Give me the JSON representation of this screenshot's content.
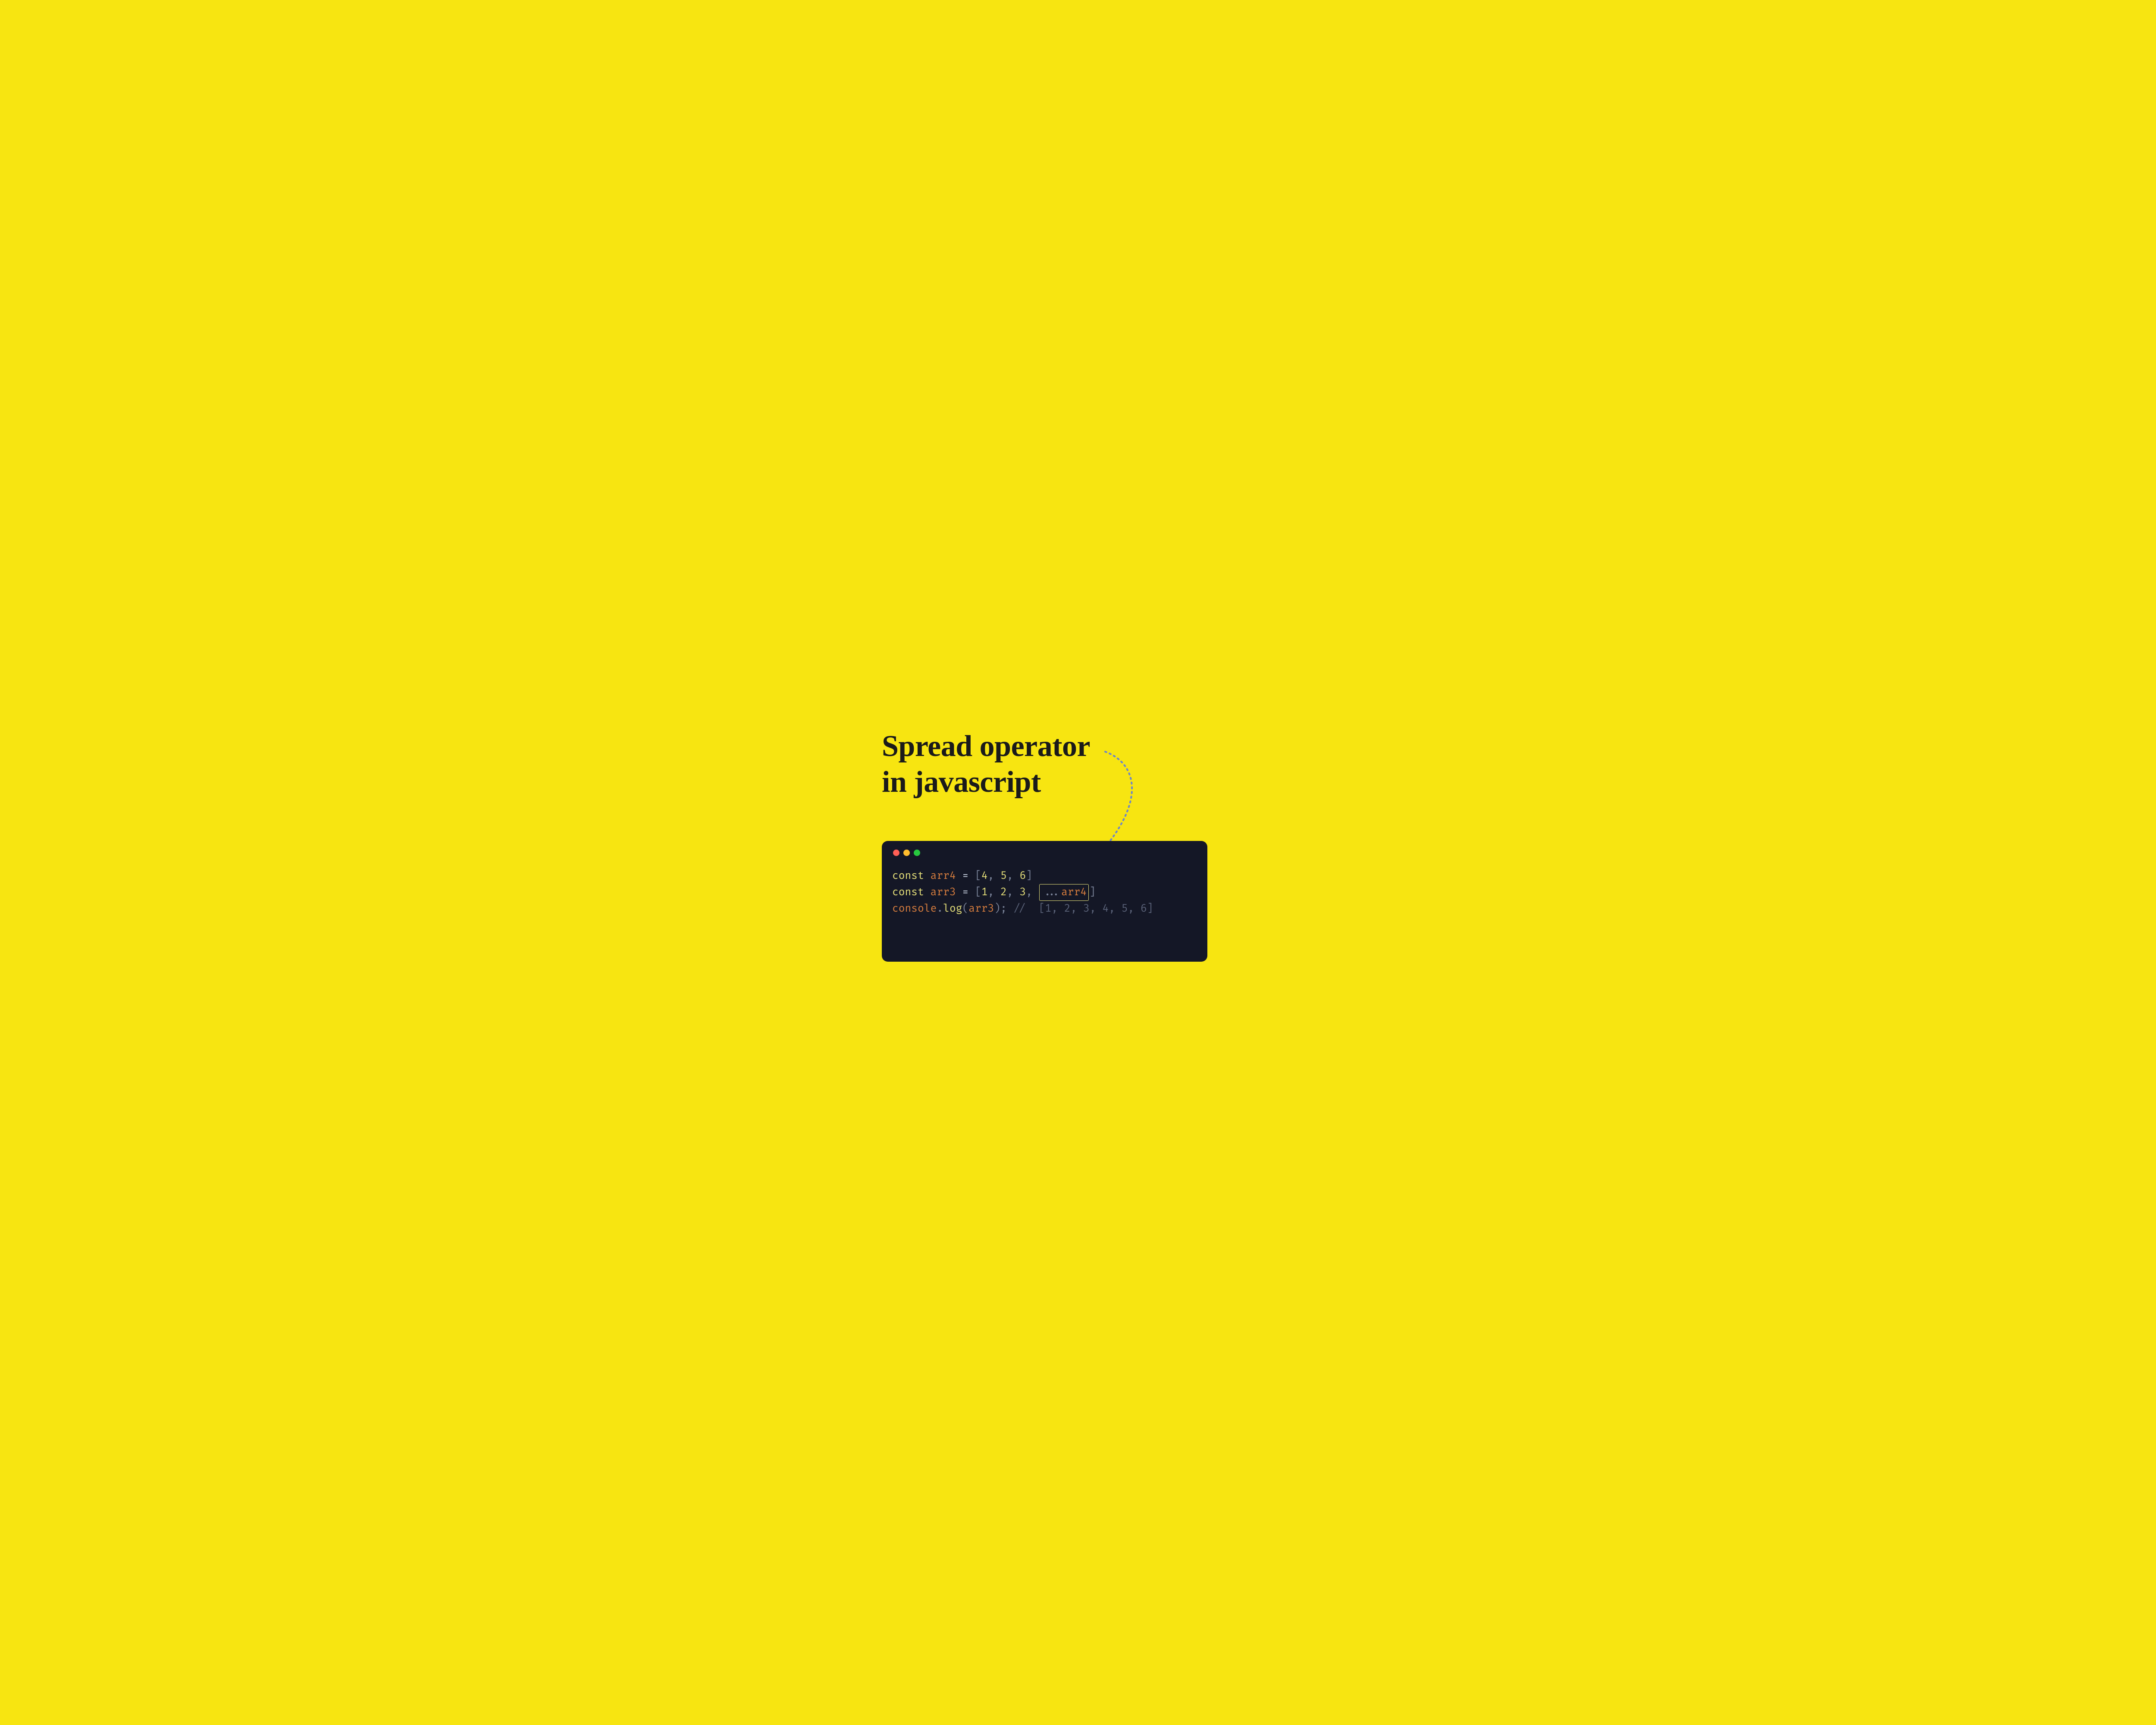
{
  "title_line1": "Spread operator",
  "title_line2": "in javascript",
  "code": {
    "line1": {
      "kw": "const",
      "var": "arr4",
      "eq": " = ",
      "open": "[",
      "n1": "4",
      "c1": ", ",
      "n2": "5",
      "c2": ", ",
      "n3": "6",
      "close": "]"
    },
    "line2": {
      "kw": "const",
      "var": "arr3",
      "eq": " = ",
      "open": "[",
      "n1": "1",
      "c1": ", ",
      "n2": "2",
      "c2": ", ",
      "n3": "3",
      "c3": ", ",
      "spread": "...",
      "spreadvar": "arr4",
      "close": "]"
    },
    "line3": {
      "obj": "console",
      "dot": ".",
      "method": "log",
      "open": "(",
      "arg": "arr3",
      "close": ")",
      "semi": ";",
      "comment": " //  [1, 2, 3, 4, 5, 6]"
    }
  }
}
